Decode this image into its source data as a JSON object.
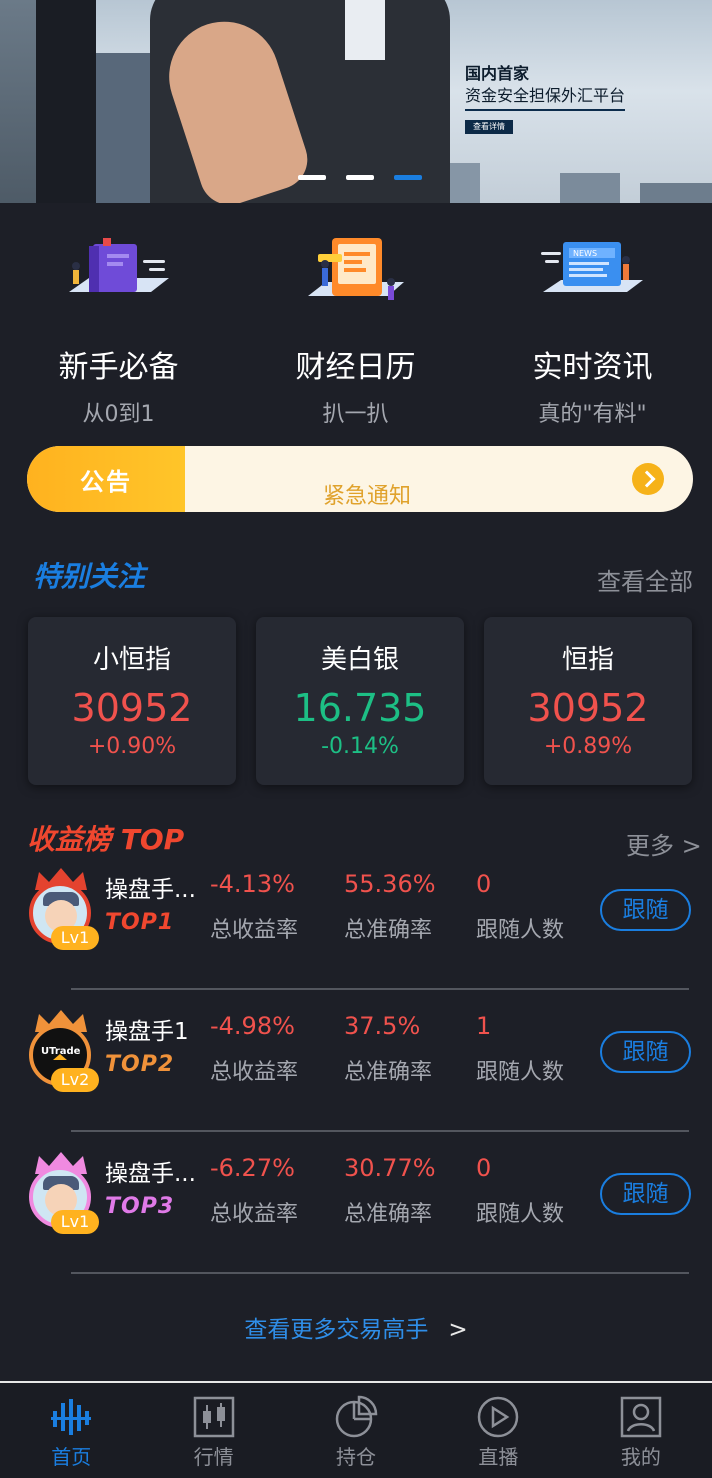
{
  "banner": {
    "title": "国内首家",
    "subtitle": "资金安全担保外汇平台",
    "detail_button": "查看详情",
    "slide_count": 3,
    "active_slide": 3
  },
  "quick_entries": [
    {
      "name": "新手必备",
      "sub": "从0到1",
      "icon": "book-icon"
    },
    {
      "name": "财经日历",
      "sub": "扒一扒",
      "icon": "calendar-icon"
    },
    {
      "name": "实时资讯",
      "sub": "真的\"有料\"",
      "icon": "news-icon"
    }
  ],
  "notice": {
    "tag": "公告",
    "message": "紧急通知"
  },
  "focus": {
    "title": "特别关注",
    "view_all": "查看全部",
    "cards": [
      {
        "name": "小恒指",
        "price": "30952",
        "change": "+0.90%",
        "trend": "up"
      },
      {
        "name": "美白银",
        "price": "16.735",
        "change": "-0.14%",
        "trend": "down"
      },
      {
        "name": "恒指",
        "price": "30952",
        "change": "+0.89%",
        "trend": "up"
      }
    ]
  },
  "ranking": {
    "title": "收益榜 TOP",
    "more": "更多 >",
    "labels": {
      "return": "总收益率",
      "accuracy": "总准确率",
      "followers": "跟随人数"
    },
    "follow_label": "跟随",
    "rows": [
      {
        "name": "操盘手...",
        "level": "Lv1",
        "top": "TOP1",
        "return": "-4.13%",
        "accuracy": "55.36%",
        "followers": "0"
      },
      {
        "name": "操盘手1",
        "level": "Lv2",
        "top": "TOP2",
        "return": "-4.98%",
        "accuracy": "37.5%",
        "followers": "1"
      },
      {
        "name": "操盘手...",
        "level": "Lv1",
        "top": "TOP3",
        "return": "-6.27%",
        "accuracy": "30.77%",
        "followers": "0"
      }
    ],
    "more_traders": "查看更多交易高手",
    "more_traders_arrow": ">"
  },
  "tabs": [
    {
      "label": "首页",
      "icon": "home-chart-icon",
      "active": true
    },
    {
      "label": "行情",
      "icon": "candlestick-icon",
      "active": false
    },
    {
      "label": "持仓",
      "icon": "pie-chart-icon",
      "active": false
    },
    {
      "label": "直播",
      "icon": "play-icon",
      "active": false
    },
    {
      "label": "我的",
      "icon": "profile-icon",
      "active": false
    }
  ],
  "colors": {
    "background": "#1d1f27",
    "accent_blue": "#1a7ee0",
    "up_red": "#f0524d",
    "down_green": "#1dbf85",
    "notice_yellow": "#ffb21f"
  }
}
